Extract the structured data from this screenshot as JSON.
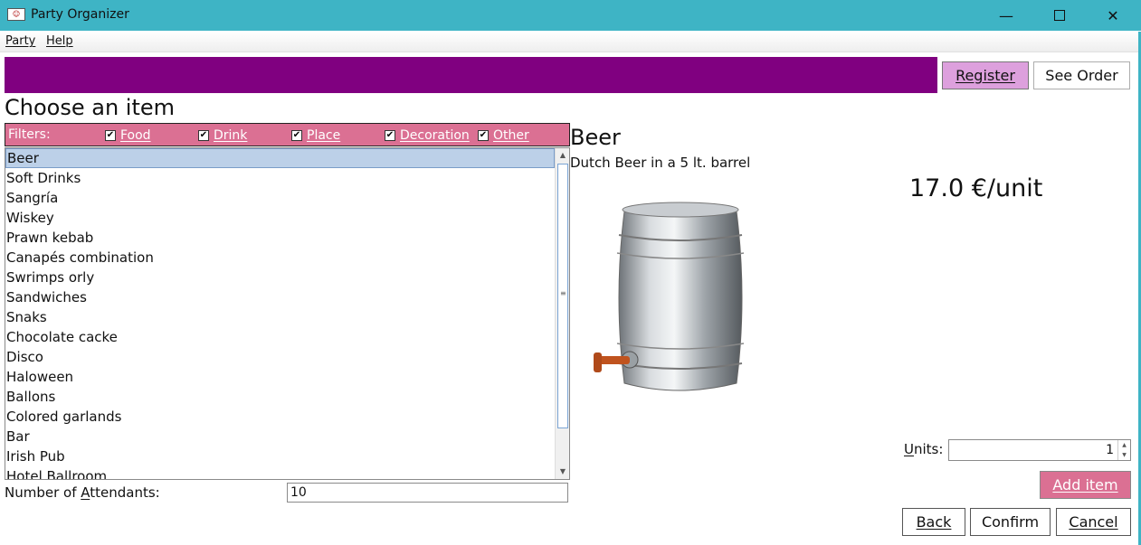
{
  "window": {
    "title": "Party Organizer",
    "minimize": "—",
    "close": "✕"
  },
  "menu": {
    "items": [
      "Party",
      "Help"
    ]
  },
  "header": {
    "register_label": "Register",
    "see_order_label": "See Order",
    "banner_color": "#800080"
  },
  "main": {
    "heading": "Choose an item",
    "filters": {
      "label": "Filters:",
      "options": [
        {
          "label": "Food",
          "checked": true
        },
        {
          "label": "Drink",
          "checked": true
        },
        {
          "label": "Place",
          "checked": true
        },
        {
          "label": "Decoration",
          "checked": true
        },
        {
          "label": "Other",
          "checked": true
        }
      ]
    },
    "items": [
      "Beer",
      "Soft Drinks",
      "Sangría",
      "Wiskey",
      "Prawn kebab",
      "Canapés combination",
      "Swrimps orly",
      "Sandwiches",
      "Snaks",
      "Chocolate cacke",
      "Disco",
      "Haloween",
      "Ballons",
      "Colored garlands",
      "Bar",
      "Irish Pub",
      "Hotel Ballroom"
    ],
    "selected_index": 0,
    "attendants": {
      "label_before": "Number of ",
      "label_accel": "A",
      "label_after": "ttendants:",
      "value": "10"
    }
  },
  "detail": {
    "name": "Beer",
    "description": "Dutch Beer in a 5 lt. barrel",
    "price": "17.0 €/unit",
    "image_icon": "beer-keg-icon",
    "units": {
      "label_accel": "U",
      "label_rest": "nits:",
      "value": "1"
    },
    "add_item_label": "Add item"
  },
  "footer": {
    "back_label": "Back",
    "confirm_label": "Confirm",
    "cancel_label": "Cancel"
  },
  "colors": {
    "titlebar": "#3eb4c5",
    "filterbar": "#db7093",
    "register": "#dda0dd",
    "add_item": "#db7093",
    "selection": "#bcd0e8"
  }
}
